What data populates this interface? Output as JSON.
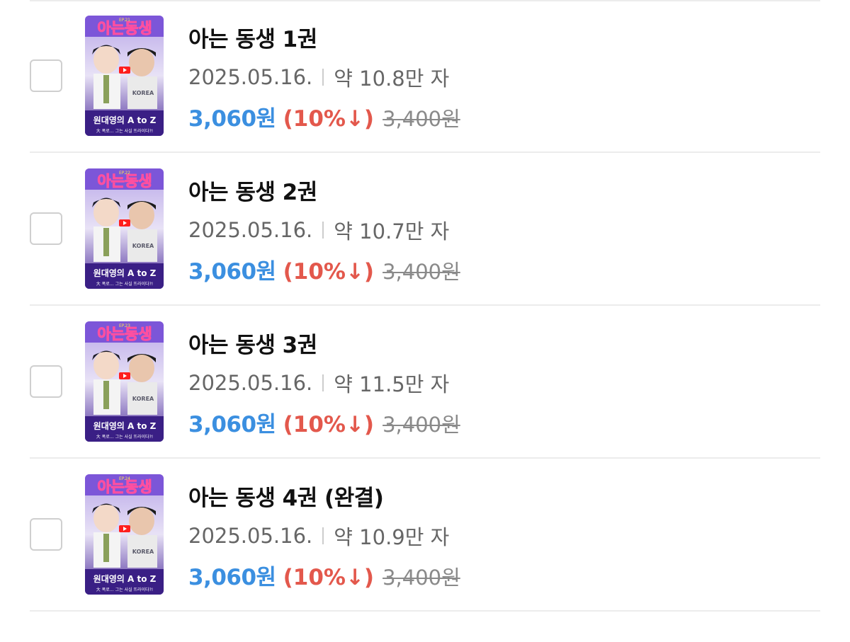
{
  "books": [
    {
      "title": "아는 동생 1권",
      "date": "2025.05.16.",
      "length": "약 10.8만 자",
      "price": "3,060원",
      "discount": "(10%↓)",
      "original_price": "3,400원",
      "cover_ep": "EP.21"
    },
    {
      "title": "아는 동생 2권",
      "date": "2025.05.16.",
      "length": "약 10.7만 자",
      "price": "3,060원",
      "discount": "(10%↓)",
      "original_price": "3,400원",
      "cover_ep": "EP.22"
    },
    {
      "title": "아는 동생 3권",
      "date": "2025.05.16.",
      "length": "약 11.5만 자",
      "price": "3,060원",
      "discount": "(10%↓)",
      "original_price": "3,400원",
      "cover_ep": "EP.23"
    },
    {
      "title": "아는 동생 4권 (완결)",
      "date": "2025.05.16.",
      "length": "약 10.9만 자",
      "price": "3,060원",
      "discount": "(10%↓)",
      "original_price": "3,400원",
      "cover_ep": "EP.24"
    }
  ],
  "cover": {
    "title": "아는동생",
    "subtitle": "원대영의 A to Z",
    "tagline": "大 폭로… 그는 사실 뜨라이다?!",
    "badge": "KOREA"
  },
  "colors": {
    "price": "#3b8fe0",
    "discount": "#e3584c",
    "original_price": "#8a8a8a",
    "cover_purple": "#6a3fc8",
    "cover_pink": "#ff4fa0"
  }
}
